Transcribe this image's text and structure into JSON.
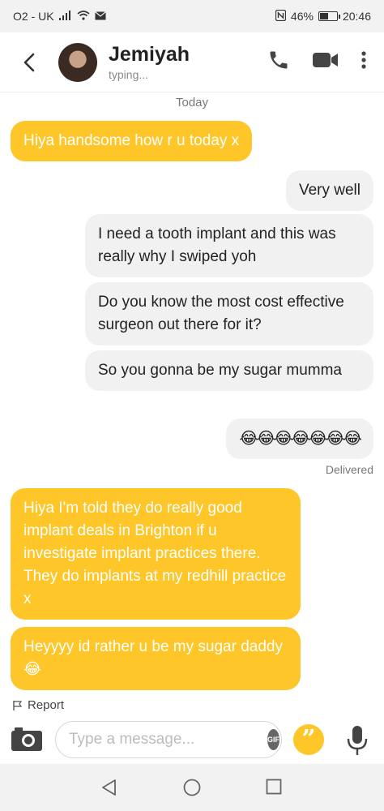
{
  "status_bar": {
    "carrier": "O2 - UK",
    "battery": "46%",
    "battery_level": 0.46,
    "time": "20:46"
  },
  "header": {
    "name": "Jemiyah",
    "status": "typing..."
  },
  "day_label": "Today",
  "messages": [
    {
      "side": "in",
      "text": "Hiya handsome how r u today x"
    },
    {
      "side": "out",
      "text": "Very well"
    },
    {
      "side": "out",
      "text": "I need a tooth implant and this was really why I swiped yoh"
    },
    {
      "side": "out",
      "text": "Do you know the most cost effective surgeon out there for it?"
    },
    {
      "side": "out",
      "text": "So you gonna be my sugar mumma"
    },
    {
      "side": "out",
      "text": "😂😂😂😂😂😂😂"
    },
    {
      "side": "in",
      "text": "Hiya I'm told they do really good implant deals in Brighton if u investigate implant practices there. They do implants at my redhill practice x"
    },
    {
      "side": "in",
      "text": "Heyyyy id rather u be my sugar daddy 😂"
    }
  ],
  "delivered_label": "Delivered",
  "report_label": "Report",
  "composer": {
    "placeholder": "Type a message...",
    "gif_label": "GIF",
    "quote_glyph": "”"
  },
  "colors": {
    "accent": "#ffc629",
    "outgoing_bubble": "#f1f1f1"
  }
}
